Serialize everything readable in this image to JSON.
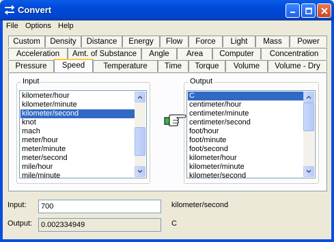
{
  "window": {
    "title": "Convert",
    "buttons": [
      "minimize-button",
      "maximize-button",
      "close-button"
    ]
  },
  "menu": [
    "File",
    "Options",
    "Help"
  ],
  "tabs": {
    "row1": [
      "Custom",
      "Density",
      "Distance",
      "Energy",
      "Flow",
      "Force",
      "Light",
      "Mass",
      "Power"
    ],
    "row2": [
      "Acceleration",
      "Amt. of Substance",
      "Angle",
      "Area",
      "Computer",
      "Concentration"
    ],
    "row3": [
      "Pressure",
      "Speed",
      "Temperature",
      "Time",
      "Torque",
      "Volume",
      "Volume - Dry"
    ],
    "selected": "Speed"
  },
  "input_group": {
    "label": "Input",
    "items": [
      "kilometer/hour",
      "kilometer/minute",
      "kilometer/second",
      "knot",
      "mach",
      "meter/hour",
      "meter/minute",
      "meter/second",
      "mile/hour",
      "mile/minute"
    ],
    "selected": "kilometer/second"
  },
  "output_group": {
    "label": "Output",
    "items": [
      "C",
      "centimeter/hour",
      "centimeter/minute",
      "centimeter/second",
      "foot/hour",
      "foot/minute",
      "foot/second",
      "kilometer/hour",
      "kilometer/minute",
      "kilometer/second"
    ],
    "selected": "C"
  },
  "fields": {
    "input_label": "Input:",
    "input_value": "700",
    "input_unit": "kilometer/second",
    "output_label": "Output:",
    "output_value": "0.002334949",
    "output_unit": "C"
  },
  "icons": {
    "app": "app-convert-icon",
    "arrow": "pointing-hand-icon"
  },
  "colors": {
    "titlebar": "#0054e3",
    "selection": "#316ac5",
    "tab_highlight": "#ffc83c"
  }
}
